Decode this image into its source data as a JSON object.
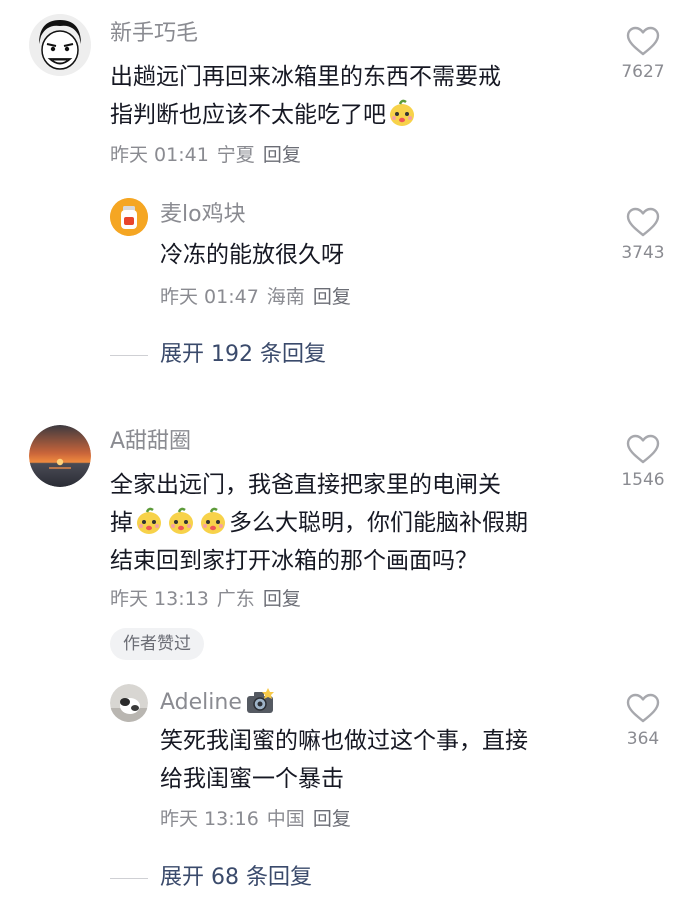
{
  "comments": [
    {
      "username": "新手巧毛",
      "lines": [
        "出趟远门再回来冰箱里的东西不需要戒",
        "指判断也应该不太能吃了吧"
      ],
      "emoji_names": [
        "lemon-face-emoji"
      ],
      "time": "昨天 01:41",
      "location": "宁夏",
      "reply_label": "回复",
      "likes": "7627",
      "reply": {
        "username": "麦lo鸡块",
        "lines": [
          "冷冻的能放很久呀"
        ],
        "time": "昨天 01:47",
        "location": "海南",
        "reply_label": "回复",
        "likes": "3743"
      },
      "expand_label": "展开 192 条回复"
    },
    {
      "username": "A甜甜圈",
      "lines": [
        "全家出远门，我爸直接把家里的电闸关",
        "掉",
        "多么大聪明，你们能脑补假期",
        "结束回到家打开冰箱的那个画面吗？"
      ],
      "emoji_names": [
        "lemon-face-emoji",
        "lemon-face-emoji",
        "lemon-face-emoji"
      ],
      "time": "昨天 13:13",
      "location": "广东",
      "reply_label": "回复",
      "likes": "1546",
      "author_badge": "作者赞过",
      "reply": {
        "username": "Adeline",
        "username_icon": "camera-flash-emoji",
        "lines": [
          "笑死我闺蜜的嘛也做过这个事，直接",
          "给我闺蜜一个暴击"
        ],
        "time": "昨天 13:16",
        "location": "中国",
        "reply_label": "回复",
        "likes": "364"
      },
      "expand_label": "展开 68 条回复"
    }
  ],
  "icons": {
    "like": "heart-outline-icon",
    "user1_avatar": "cartoon-face-avatar",
    "user2_avatar": "milk-bottle-avatar",
    "user3_avatar": "sunset-sea-avatar",
    "user4_avatar": "cat-photo-avatar"
  },
  "colors": {
    "text": "#161823",
    "meta": "#8a8b91",
    "expand": "#3a4a6b",
    "heart": "#a7a8ad"
  }
}
